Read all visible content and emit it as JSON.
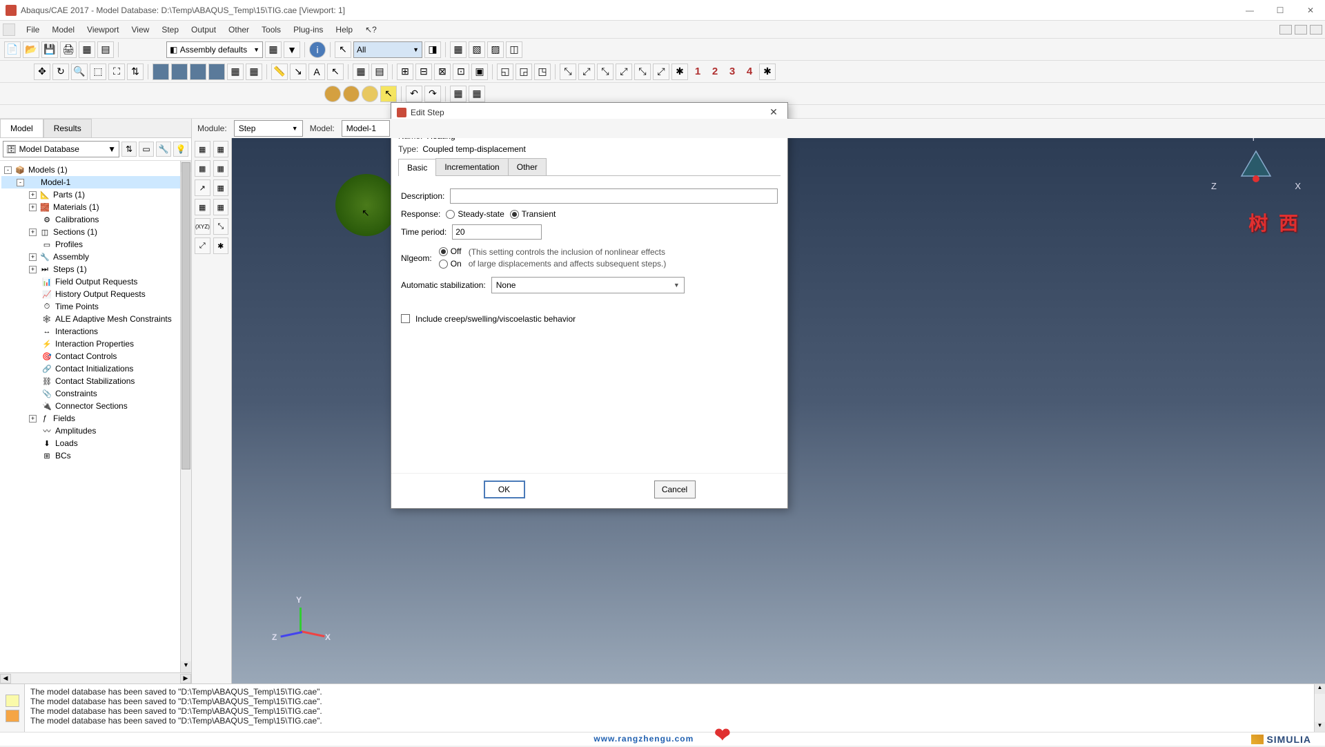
{
  "titlebar": {
    "title": "Abaqus/CAE 2017 - Model Database: D:\\Temp\\ABAQUS_Temp\\15\\TIG.cae [Viewport: 1]"
  },
  "menu": {
    "items": [
      "File",
      "Model",
      "Viewport",
      "View",
      "Step",
      "Output",
      "Other",
      "Tools",
      "Plug-ins",
      "Help"
    ]
  },
  "toolbar1": {
    "assembly_combo": "Assembly defaults",
    "filter_combo": "All",
    "red_numbers": [
      "1",
      "2",
      "3",
      "4"
    ]
  },
  "modulebar": {
    "module_label": "Module:",
    "module_value": "Step",
    "model_label": "Model:",
    "model_value": "Model-1"
  },
  "left_panel": {
    "tab_model": "Model",
    "tab_results": "Results",
    "db_combo": "Model Database",
    "tree": [
      {
        "indent": 0,
        "expand": "-",
        "icon": "📦",
        "label": "Models (1)"
      },
      {
        "indent": 1,
        "expand": "-",
        "icon": "",
        "label": "Model-1",
        "selected": true
      },
      {
        "indent": 2,
        "expand": "+",
        "icon": "📐",
        "label": "Parts (1)"
      },
      {
        "indent": 2,
        "expand": "+",
        "icon": "🧱",
        "label": "Materials (1)"
      },
      {
        "indent": 2,
        "expand": "",
        "icon": "⚙",
        "label": "Calibrations"
      },
      {
        "indent": 2,
        "expand": "+",
        "icon": "◫",
        "label": "Sections (1)"
      },
      {
        "indent": 2,
        "expand": "",
        "icon": "▭",
        "label": "Profiles"
      },
      {
        "indent": 2,
        "expand": "+",
        "icon": "🔧",
        "label": "Assembly"
      },
      {
        "indent": 2,
        "expand": "+",
        "icon": "⏭",
        "label": "Steps (1)"
      },
      {
        "indent": 2,
        "expand": "",
        "icon": "📊",
        "label": "Field Output Requests"
      },
      {
        "indent": 2,
        "expand": "",
        "icon": "📈",
        "label": "History Output Requests"
      },
      {
        "indent": 2,
        "expand": "",
        "icon": "⏱",
        "label": "Time Points"
      },
      {
        "indent": 2,
        "expand": "",
        "icon": "🕸",
        "label": "ALE Adaptive Mesh Constraints"
      },
      {
        "indent": 2,
        "expand": "",
        "icon": "↔",
        "label": "Interactions"
      },
      {
        "indent": 2,
        "expand": "",
        "icon": "⚡",
        "label": "Interaction Properties"
      },
      {
        "indent": 2,
        "expand": "",
        "icon": "🎯",
        "label": "Contact Controls"
      },
      {
        "indent": 2,
        "expand": "",
        "icon": "🔗",
        "label": "Contact Initializations"
      },
      {
        "indent": 2,
        "expand": "",
        "icon": "⛓",
        "label": "Contact Stabilizations"
      },
      {
        "indent": 2,
        "expand": "",
        "icon": "📎",
        "label": "Constraints"
      },
      {
        "indent": 2,
        "expand": "",
        "icon": "🔌",
        "label": "Connector Sections"
      },
      {
        "indent": 2,
        "expand": "+",
        "icon": "ƒ",
        "label": "Fields"
      },
      {
        "indent": 2,
        "expand": "",
        "icon": "〰",
        "label": "Amplitudes"
      },
      {
        "indent": 2,
        "expand": "",
        "icon": "⬇",
        "label": "Loads"
      },
      {
        "indent": 2,
        "expand": "",
        "icon": "⊞",
        "label": "BCs"
      }
    ]
  },
  "viewport": {
    "triad_y": "Y",
    "triad_x": "X",
    "triad_z": "Z",
    "compass_y": "Y",
    "compass_x": "X",
    "compass_z": "Z",
    "watermark": "树 西"
  },
  "dialog": {
    "title": "Edit Step",
    "name_label": "Name:",
    "name_value": "Heating",
    "type_label": "Type:",
    "type_value": "Coupled temp-displacement",
    "tabs": {
      "basic": "Basic",
      "incrementation": "Incrementation",
      "other": "Other"
    },
    "desc_label": "Description:",
    "desc_value": "",
    "response_label": "Response:",
    "response_steady": "Steady-state",
    "response_transient": "Transient",
    "time_period_label": "Time period:",
    "time_period_value": "20",
    "nlgeom_label": "Nlgeom:",
    "nlgeom_off": "Off",
    "nlgeom_on": "On",
    "nlgeom_note1": "(This setting controls the inclusion of nonlinear effects",
    "nlgeom_note2": "of large displacements and affects subsequent steps.)",
    "autostab_label": "Automatic stabilization:",
    "autostab_value": "None",
    "creep_label": "Include creep/swelling/viscoelastic behavior",
    "ok": "OK",
    "cancel": "Cancel"
  },
  "messages": {
    "lines": [
      "The model database has been saved to \"D:\\Temp\\ABAQUS_Temp\\15\\TIG.cae\".",
      "The model database has been saved to \"D:\\Temp\\ABAQUS_Temp\\15\\TIG.cae\".",
      "The model database has been saved to \"D:\\Temp\\ABAQUS_Temp\\15\\TIG.cae\".",
      "The model database has been saved to \"D:\\Temp\\ABAQUS_Temp\\15\\TIG.cae\"."
    ]
  },
  "footer": {
    "brand": "SIMULIA"
  },
  "bottom": {
    "url": "www.rangzhengu.com"
  }
}
